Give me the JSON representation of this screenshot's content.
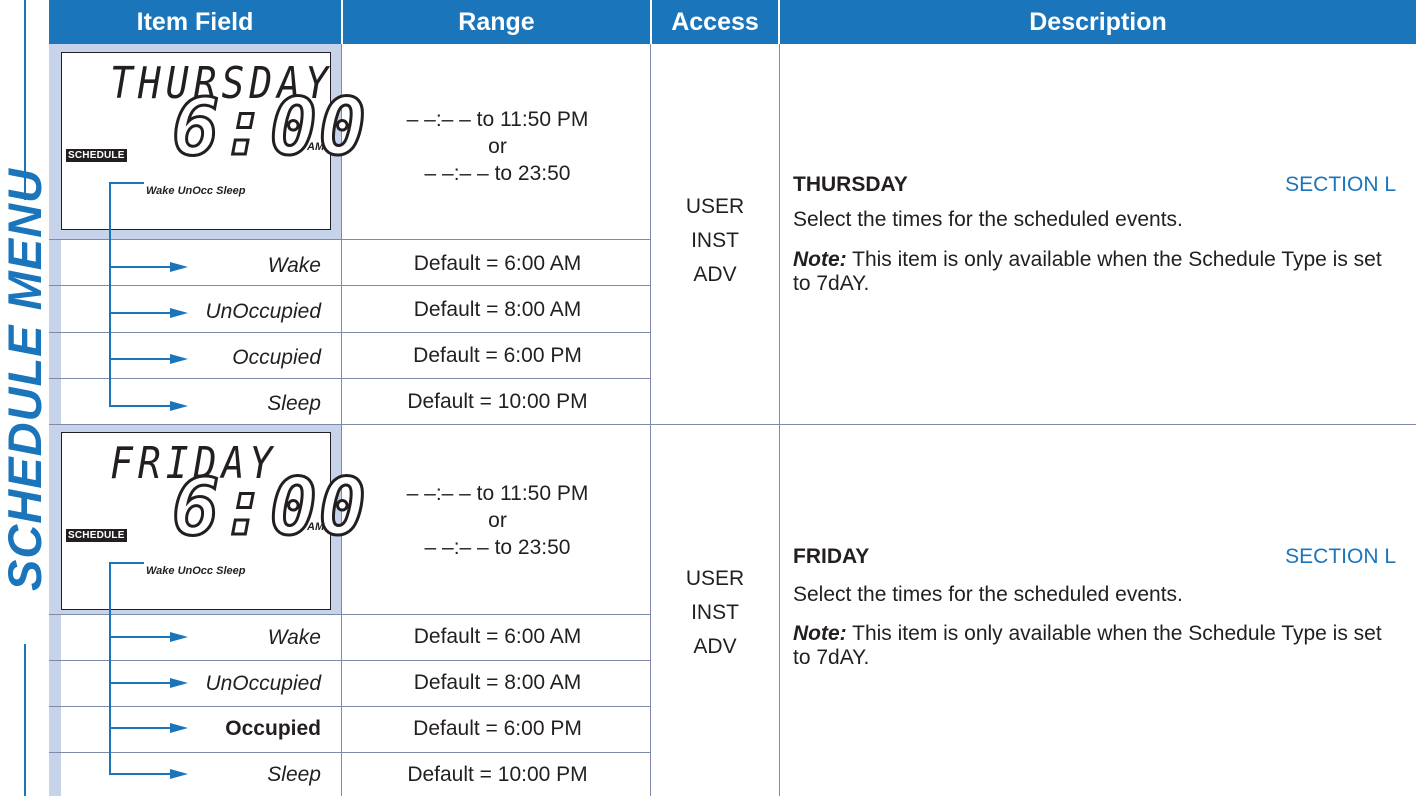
{
  "side_title": "SCHEDULE MENU",
  "headers": {
    "item_field": "Item Field",
    "range": "Range",
    "access": "Access",
    "description": "Description"
  },
  "rows": [
    {
      "lcd": {
        "day": "THURSDAY",
        "time": "6:00",
        "ampm": "AM",
        "badge": "SCHEDULE",
        "labels": "Wake UnOcc Sleep"
      },
      "range": {
        "line1": "– –:– – to 11:50 PM",
        "line2": "or",
        "line3": "– –:– – to 23:50"
      },
      "access": {
        "a": "USER",
        "b": "INST",
        "c": "ADV"
      },
      "subs": [
        {
          "label": "Wake",
          "default": "Default = 6:00 AM"
        },
        {
          "label": "UnOccupied",
          "default": "Default = 8:00 AM"
        },
        {
          "label": "Occupied",
          "default": "Default = 6:00 PM"
        },
        {
          "label": "Sleep",
          "default": "Default = 10:00 PM"
        }
      ],
      "desc": {
        "title": "THURSDAY",
        "section": "SECTION L",
        "body": "Select the times for the scheduled events.",
        "note_label": "Note:",
        "note_text": " This item is only available when the Schedule Type is set to 7dAY."
      }
    },
    {
      "lcd": {
        "day": "FRIDAY",
        "time": "6:00",
        "ampm": "AM",
        "badge": "SCHEDULE",
        "labels": "Wake UnOcc Sleep"
      },
      "range": {
        "line1": "– –:– – to 11:50 PM",
        "line2": "or",
        "line3": "– –:– – to 23:50"
      },
      "access": {
        "a": "USER",
        "b": "INST",
        "c": "ADV"
      },
      "subs": [
        {
          "label": "Wake",
          "default": "Default = 6:00 AM"
        },
        {
          "label": "UnOccupied",
          "default": "Default = 8:00 AM"
        },
        {
          "label": "Occupied",
          "default": "Default = 6:00 PM"
        },
        {
          "label": "Sleep",
          "default": "Default = 10:00 PM"
        }
      ],
      "desc": {
        "title": "FRIDAY",
        "section": "SECTION L",
        "body": "Select the times for the scheduled events.",
        "note_label": "Note:",
        "note_text": " This item is only available when the Schedule Type is set to 7dAY."
      }
    }
  ],
  "colors": {
    "accent": "#1b75bb",
    "cell_fill": "#c6d3ea",
    "grid": "#7d8aa8"
  }
}
